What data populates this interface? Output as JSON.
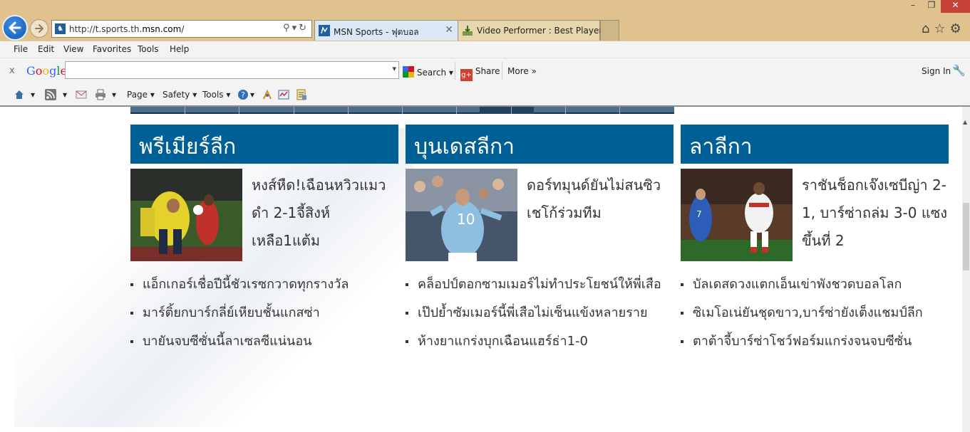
{
  "browser": {
    "address_url_prefix": "http://t.sports.th.",
    "address_url_domain": "msn.com",
    "address_url_suffix": "/",
    "tabs": [
      {
        "label": "MSN Sports - ฟุตบอล",
        "active": true
      },
      {
        "label": "Video Performer : Best Player",
        "active": false
      }
    ],
    "menu": [
      "File",
      "Edit",
      "View",
      "Favorites",
      "Tools",
      "Help"
    ],
    "window_controls": {
      "minimize": "–",
      "restore": "❐",
      "close": "✕"
    }
  },
  "google_toolbar": {
    "close": "x",
    "logo": "Google",
    "search_value": "",
    "search_label": "Search",
    "share_label": "Share",
    "more_label": "More »",
    "sign_in_label": "Sign In"
  },
  "command_bar": {
    "page_label": "Page",
    "safety_label": "Safety",
    "tools_label": "Tools"
  },
  "columns": [
    {
      "heading": "พรีเมียร์ลีก",
      "headline": "หงส์หืด!เฉือนหวิวแมวดำ 2-1จี้สิงห์เหลือ1แต้ม",
      "items": [
        "แอ็กเกอร์เชื่อปีนี้ชัวเรซกวาดทุกรางวัล",
        "มาร์ติ้ยกบาร์กลี่ย์เหียบชั้นแกสซ่า",
        "บายันจบซีซั่นนี้ลาเซลซีแน่นอน"
      ]
    },
    {
      "heading": "บุนเดสลีกา",
      "headline": "ดอร์ทมุนด์ยันไม่สนซิวเชโก้ร่วมทีม",
      "items": [
        "คล็อปป์ตอกซามเมอร์ไม่ทำประโยชน์ให้พี่เสือ",
        "เป๊ปย้ำซัมเมอร์นี้พี่เสือไม่เซ็นแข้งหลายราย",
        "ห้างยาแกร่งบุกเฉือนแฮร์ธ่า1-0"
      ]
    },
    {
      "heading": "ลาลีกา",
      "headline": "ราชันช็อกเจ๊งเซบีญ่า 2-1, บาร์ซ่าถล่ม 3-0 แซงขึ้นที่ 2",
      "items": [
        "บัลเดสดวงแตกเอ็นเข่าพังชวดบอลโลก",
        "ซิเมโอเน่ยันชุดขาว,บาร์ซ่ายังเต็งแชมป์ลีก",
        "ตาต้าจี้บาร์ซ่าโชว์ฟอร์มแกร่งจนจบซีซั่น"
      ]
    }
  ],
  "colors": {
    "section_header": "#005f94",
    "chrome": "#dfc28e",
    "close_button": "#c7433a"
  }
}
